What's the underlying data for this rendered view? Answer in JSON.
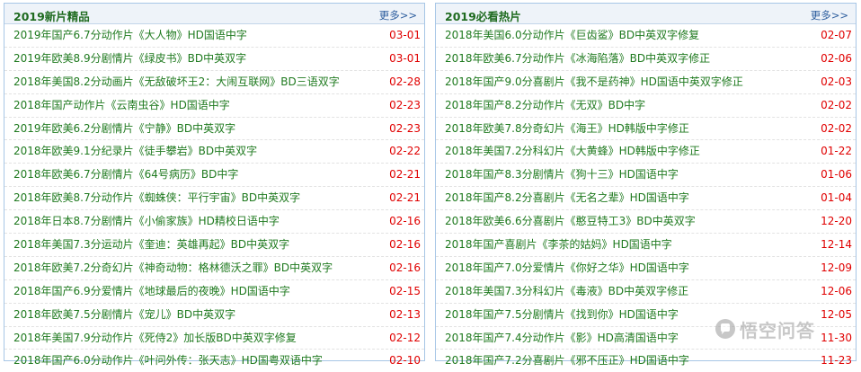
{
  "left": {
    "title": "2019新片精品",
    "more": "更多>>",
    "items": [
      {
        "title": "2019年国产6.7分动作片《大人物》HD国语中字",
        "date": "03-01"
      },
      {
        "title": "2019年欧美8.9分剧情片《绿皮书》BD中英双字",
        "date": "03-01"
      },
      {
        "title": "2018年美国8.2分动画片《无敌破坏王2：大闹互联网》BD三语双字",
        "date": "02-28"
      },
      {
        "title": "2018年国产动作片《云南虫谷》HD国语中字",
        "date": "02-23"
      },
      {
        "title": "2019年欧美6.2分剧情片《宁静》BD中英双字",
        "date": "02-23"
      },
      {
        "title": "2018年欧美9.1分纪录片《徒手攀岩》BD中英双字",
        "date": "02-22"
      },
      {
        "title": "2018年欧美6.7分剧情片《64号病历》BD中字",
        "date": "02-21"
      },
      {
        "title": "2018年欧美8.7分动作片《蜘蛛侠：平行宇宙》BD中英双字",
        "date": "02-21"
      },
      {
        "title": "2018年日本8.7分剧情片《小偷家族》HD精校日语中字",
        "date": "02-16"
      },
      {
        "title": "2018年美国7.3分运动片《奎迪：英雄再起》BD中英双字",
        "date": "02-16"
      },
      {
        "title": "2018年欧美7.2分奇幻片《神奇动物：格林德沃之罪》BD中英双字",
        "date": "02-16"
      },
      {
        "title": "2018年国产6.9分爱情片《地球最后的夜晚》HD国语中字",
        "date": "02-15"
      },
      {
        "title": "2018年欧美7.5分剧情片《宠儿》BD中英双字",
        "date": "02-13"
      },
      {
        "title": "2018年美国7.9分动作片《死侍2》加长版BD中英双字修复",
        "date": "02-12"
      },
      {
        "title": "2018年国产6.0分动作片《叶问外传：张天志》HD国粤双语中字",
        "date": "02-10"
      }
    ]
  },
  "right": {
    "title": "2019必看热片",
    "more": "更多>>",
    "items": [
      {
        "title": "2018年美国6.0分动作片《巨齿鲨》BD中英双字修复",
        "date": "02-07"
      },
      {
        "title": "2018年欧美6.7分动作片《冰海陷落》BD中英双字修正",
        "date": "02-06"
      },
      {
        "title": "2018年国产9.0分喜剧片《我不是药神》HD国语中英双字修正",
        "date": "02-03"
      },
      {
        "title": "2018年国产8.2分动作片《无双》BD中字",
        "date": "02-02"
      },
      {
        "title": "2018年欧美7.8分奇幻片《海王》HD韩版中字修正",
        "date": "02-02"
      },
      {
        "title": "2018年美国7.2分科幻片《大黄蜂》HD韩版中字修正",
        "date": "01-22"
      },
      {
        "title": "2018年国产8.3分剧情片《狗十三》HD国语中字",
        "date": "01-06"
      },
      {
        "title": "2018年国产8.2分喜剧片《无名之辈》HD国语中字",
        "date": "01-04"
      },
      {
        "title": "2018年欧美6.6分喜剧片《憨豆特工3》BD中英双字",
        "date": "12-20"
      },
      {
        "title": "2018年国产喜剧片《李茶的姑妈》HD国语中字",
        "date": "12-14"
      },
      {
        "title": "2018年国产7.0分爱情片《你好之华》HD国语中字",
        "date": "12-09"
      },
      {
        "title": "2018年美国7.3分科幻片《毒液》BD中英双字修正",
        "date": "12-06"
      },
      {
        "title": "2018年国产7.5分剧情片《找到你》HD国语中字",
        "date": "12-05"
      },
      {
        "title": "2018年国产7.4分动作片《影》HD高清国语中字",
        "date": "11-30"
      },
      {
        "title": "2018年国产7.2分喜剧片《邪不压正》HD国语中字",
        "date": "11-23"
      }
    ]
  },
  "watermark": {
    "text": "悟空问答",
    "icon": "chat-bubble-icon"
  }
}
